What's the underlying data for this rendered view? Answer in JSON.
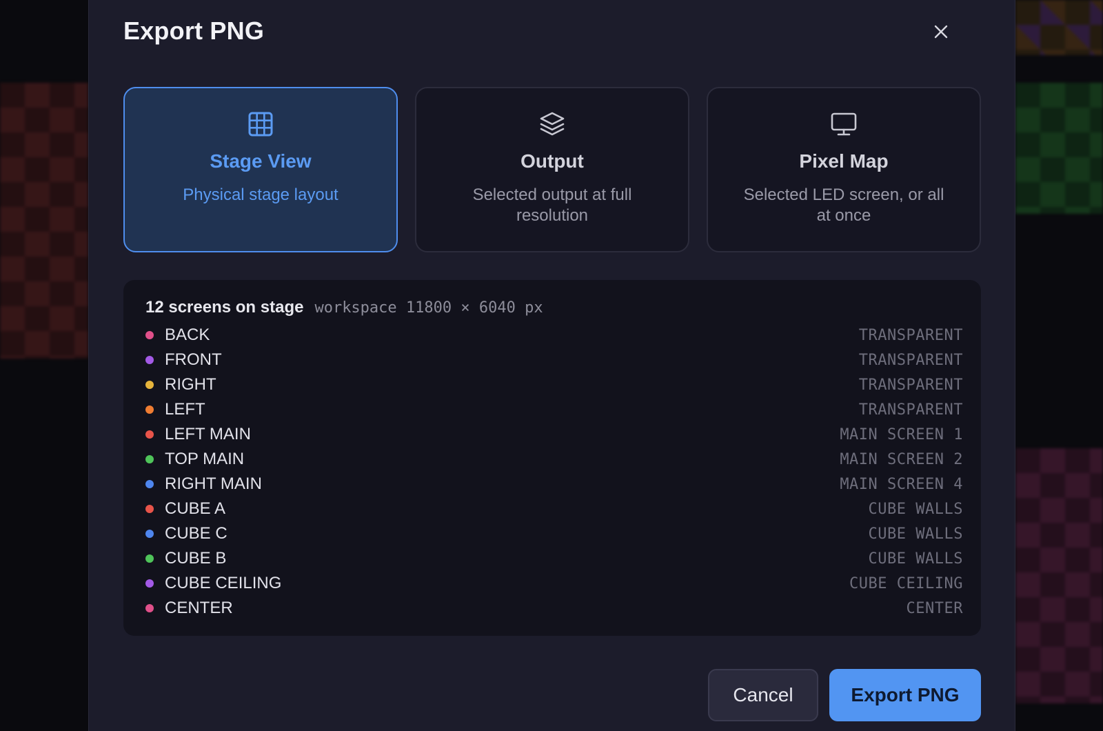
{
  "dialog": {
    "title": "Export PNG",
    "close_icon": "close-icon"
  },
  "modes": [
    {
      "icon": "grid-icon",
      "title": "Stage View",
      "description": "Physical stage layout",
      "selected": true
    },
    {
      "icon": "layers-icon",
      "title": "Output",
      "description": "Selected output at full resolution",
      "selected": false
    },
    {
      "icon": "monitor-icon",
      "title": "Pixel Map",
      "description": "Selected LED screen, or all at once",
      "selected": false
    }
  ],
  "summary": {
    "count_label": "12 screens on stage",
    "workspace_label": "workspace 11800 × 6040 px"
  },
  "screens": [
    {
      "name": "BACK",
      "group": "TRANSPARENT",
      "color": "#e0508a"
    },
    {
      "name": "FRONT",
      "group": "TRANSPARENT",
      "color": "#a35ae6"
    },
    {
      "name": "RIGHT",
      "group": "TRANSPARENT",
      "color": "#e6b43c"
    },
    {
      "name": "LEFT",
      "group": "TRANSPARENT",
      "color": "#f07d32"
    },
    {
      "name": "LEFT MAIN",
      "group": "MAIN SCREEN 1",
      "color": "#e8544a"
    },
    {
      "name": "TOP MAIN",
      "group": "MAIN SCREEN 2",
      "color": "#4fc45a"
    },
    {
      "name": "RIGHT MAIN",
      "group": "MAIN SCREEN 4",
      "color": "#4f86ee"
    },
    {
      "name": "CUBE A",
      "group": "CUBE WALLS",
      "color": "#e8544a"
    },
    {
      "name": "CUBE C",
      "group": "CUBE WALLS",
      "color": "#4f86ee"
    },
    {
      "name": "CUBE B",
      "group": "CUBE WALLS",
      "color": "#4fc45a"
    },
    {
      "name": "CUBE CEILING",
      "group": "CUBE CEILING",
      "color": "#a35ae6"
    },
    {
      "name": "CENTER",
      "group": "CENTER",
      "color": "#e0508a"
    }
  ],
  "footer": {
    "cancel_label": "Cancel",
    "export_label": "Export PNG"
  },
  "colors": {
    "accent": "#5295f2",
    "selected_card_bg": "#203352",
    "dialog_bg": "#1c1c2b"
  }
}
